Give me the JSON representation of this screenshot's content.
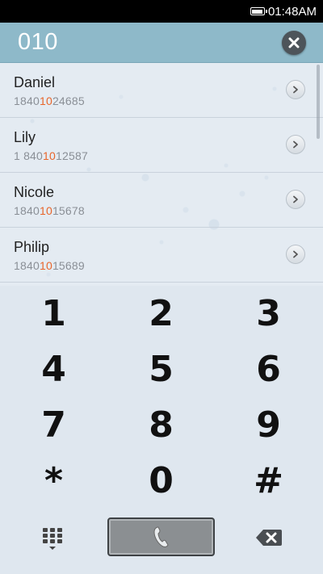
{
  "status_bar": {
    "time": "01:48AM"
  },
  "dialer": {
    "number": "010"
  },
  "contacts": [
    {
      "name": "Daniel",
      "number_before": "1840",
      "number_match": "10",
      "number_after": "24685"
    },
    {
      "name": "Lily",
      "number_before": "1 840",
      "number_match": "10",
      "number_after": "12587"
    },
    {
      "name": "Nicole",
      "number_before": "1840",
      "number_match": "10",
      "number_after": "15678"
    },
    {
      "name": "Philip",
      "number_before": "1840",
      "number_match": "10",
      "number_after": "15689"
    }
  ],
  "keypad": {
    "keys": [
      "1",
      "2",
      "3",
      "4",
      "5",
      "6",
      "7",
      "8",
      "9",
      "*",
      "0",
      "#"
    ]
  },
  "icons": {
    "clear": "close-icon",
    "detail": "chevron-right-icon",
    "keypad_toggle": "dialpad-icon",
    "call": "phone-icon",
    "backspace": "backspace-icon"
  },
  "colors": {
    "header": "#8eb9c9",
    "match_highlight": "#e8652a",
    "call_button": "#8b8f92"
  }
}
